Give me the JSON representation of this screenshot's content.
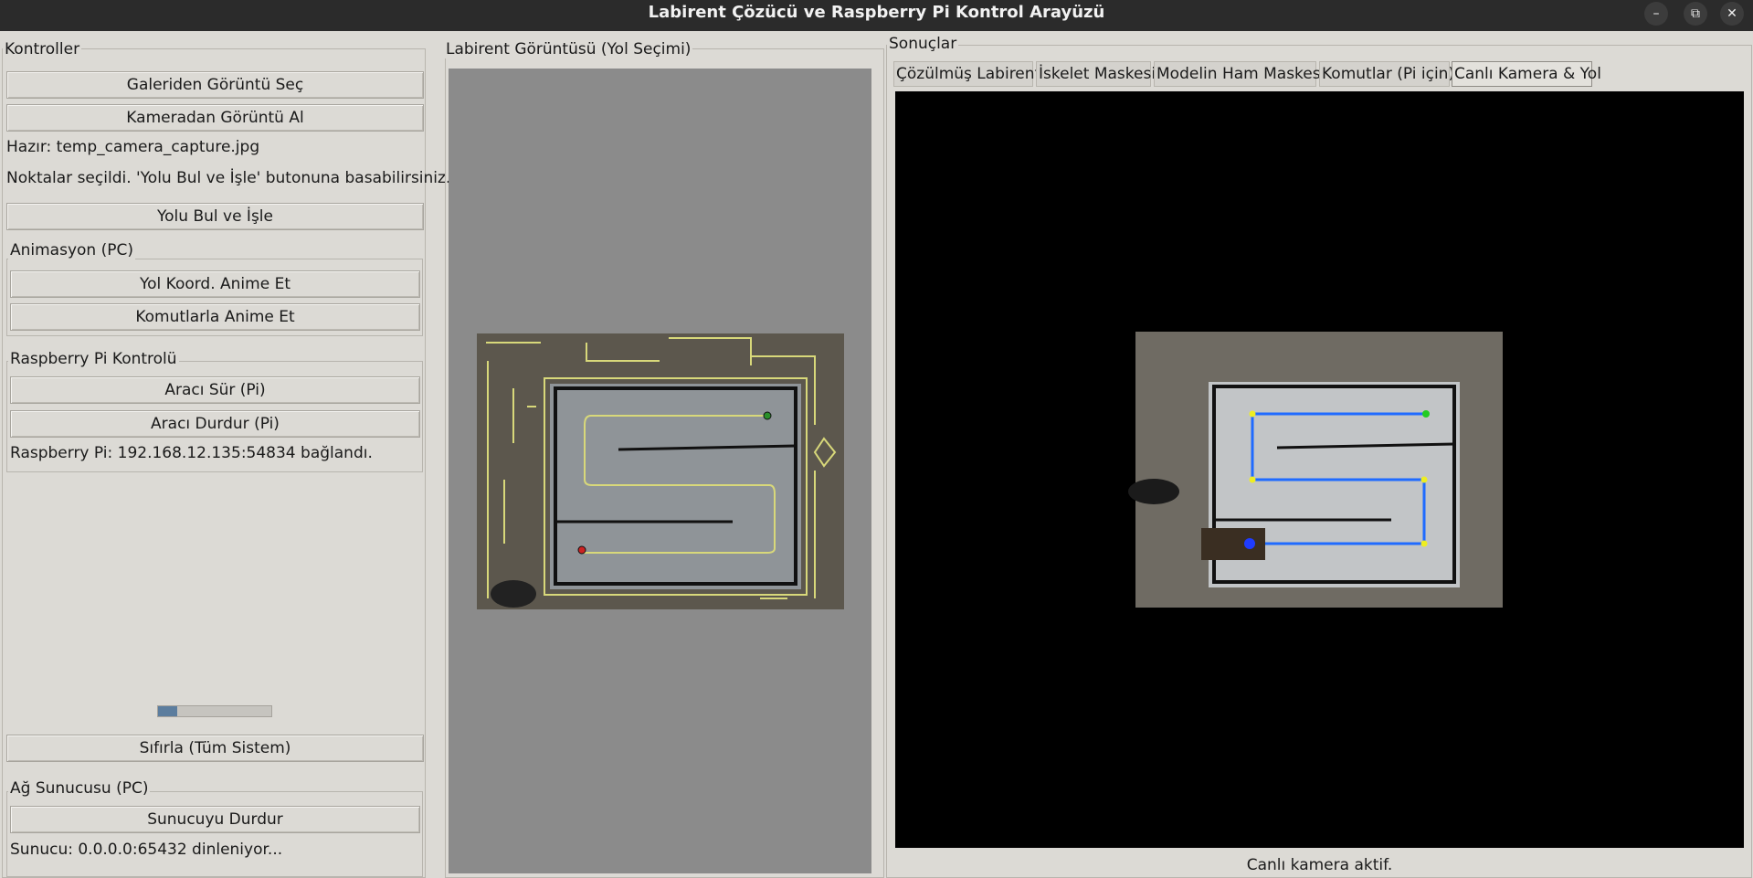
{
  "window": {
    "title": "Labirent Çözücü ve Raspberry Pi Kontrol Arayüzü",
    "controls": [
      "minimize-icon",
      "restore-icon",
      "close-icon"
    ]
  },
  "left": {
    "legend": "Kontroller",
    "btn_gallery": "Galeriden Görüntü Seç",
    "btn_camera": "Kameradan Görüntü Al",
    "status_ready": "Hazır: temp_camera_capture.jpg",
    "status_points": "Noktalar seçildi. 'Yolu Bul ve İşle' butonuna basabilirsiniz.",
    "btn_solve": "Yolu Bul ve İşle",
    "animation": {
      "legend": "Animasyon (PC)",
      "btn_coords": "Yol Koord. Anime Et",
      "btn_commands": "Komutlarla Anime Et"
    },
    "pi": {
      "legend": "Raspberry Pi Kontrolü",
      "btn_drive": "Aracı Sür (Pi)",
      "btn_stop": "Aracı Durdur (Pi)",
      "status": "Raspberry Pi: 192.168.12.135:54834 bağlandı."
    },
    "progress": 0.17,
    "btn_reset": "Sıfırla (Tüm Sistem)",
    "server": {
      "legend": "Ağ Sunucusu (PC)",
      "btn_stop_server": "Sunucuyu Durdur",
      "status": "Sunucu: 0.0.0.0:65432 dinleniyor..."
    }
  },
  "middle": {
    "legend": "Labirent Görüntüsü (Yol Seçimi)"
  },
  "right": {
    "legend": "Sonuçlar",
    "tabs": [
      {
        "label": "Çözülmüş Labirent"
      },
      {
        "label": "İskelet Maskesi"
      },
      {
        "label": "Modelin Ham Maskesi"
      },
      {
        "label": "Komutlar (Pi için)"
      },
      {
        "label": "Canlı Kamera & Yol"
      }
    ],
    "active_tab": "Canlı Kamera & Yol",
    "status": "Canlı kamera aktif."
  },
  "colors": {
    "titlebar": "#2b2b2b",
    "window_bg": "#dcdad5",
    "maze_overlay": "#d8d87a",
    "path_blue": "#1f6bff",
    "start_green": "#22cc22",
    "end_red": "#dd2222"
  }
}
